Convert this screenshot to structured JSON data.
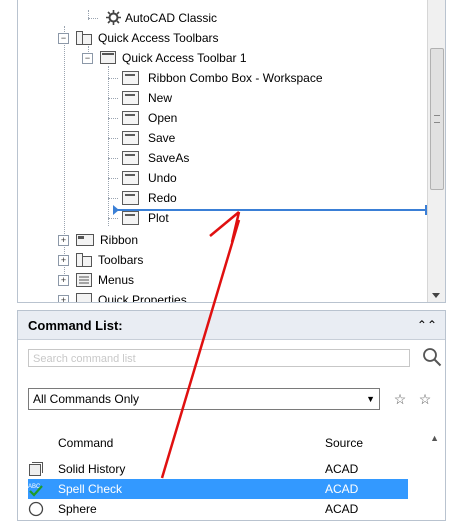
{
  "tree": {
    "items": [
      {
        "label": "AutoCAD Classic",
        "icon": "gear-icon"
      },
      {
        "label": "Quick Access Toolbars",
        "icon": "toolbars-icon"
      },
      {
        "label": "Quick Access Toolbar 1",
        "icon": "toolbar-icon"
      },
      {
        "label": "Ribbon Combo Box - Workspace",
        "icon": "toolbar-button-icon"
      },
      {
        "label": "New",
        "icon": "toolbar-button-icon"
      },
      {
        "label": "Open",
        "icon": "toolbar-button-icon"
      },
      {
        "label": "Save",
        "icon": "toolbar-button-icon"
      },
      {
        "label": "SaveAs",
        "icon": "toolbar-button-icon"
      },
      {
        "label": "Undo",
        "icon": "toolbar-button-icon"
      },
      {
        "label": "Redo",
        "icon": "toolbar-button-icon"
      },
      {
        "label": "Plot",
        "icon": "toolbar-button-icon"
      },
      {
        "label": "Ribbon",
        "icon": "ribbon-icon"
      },
      {
        "label": "Toolbars",
        "icon": "toolbars-icon"
      },
      {
        "label": "Menus",
        "icon": "menus-icon"
      },
      {
        "label": "Quick Properties",
        "icon": "properties-icon"
      }
    ]
  },
  "command_list": {
    "title": "Command List:",
    "search_placeholder": "Search command list",
    "filter_selected": "All Commands Only",
    "col_command": "Command",
    "col_source": "Source",
    "rows": [
      {
        "command": "Solid History",
        "source": "ACAD",
        "selected": false,
        "icon": "solid-history-icon"
      },
      {
        "command": "Spell Check",
        "source": "ACAD",
        "selected": true,
        "icon": "spell-check-icon"
      },
      {
        "command": "Sphere",
        "source": "ACAD",
        "selected": false,
        "icon": "sphere-icon"
      }
    ]
  },
  "colors": {
    "selection": "#3399ff",
    "drop_indicator": "#3a7fd6",
    "arrow": "#e01010"
  }
}
